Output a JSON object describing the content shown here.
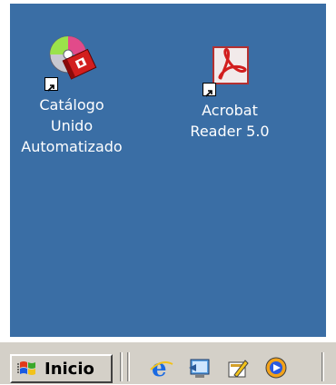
{
  "desktop": {
    "background": "#3a6ea5",
    "icons": [
      {
        "label": "Catálogo\nUnido\nAutomatizado",
        "icon": "cd-catalog-icon"
      },
      {
        "label": "Acrobat\nReader 5.0",
        "icon": "acrobat-reader-icon"
      }
    ]
  },
  "taskbar": {
    "start_label": "Inicio",
    "quick_launch": [
      {
        "icon": "internet-explorer-icon"
      },
      {
        "icon": "show-desktop-icon"
      },
      {
        "icon": "outlook-express-icon"
      },
      {
        "icon": "media-player-icon"
      }
    ]
  }
}
